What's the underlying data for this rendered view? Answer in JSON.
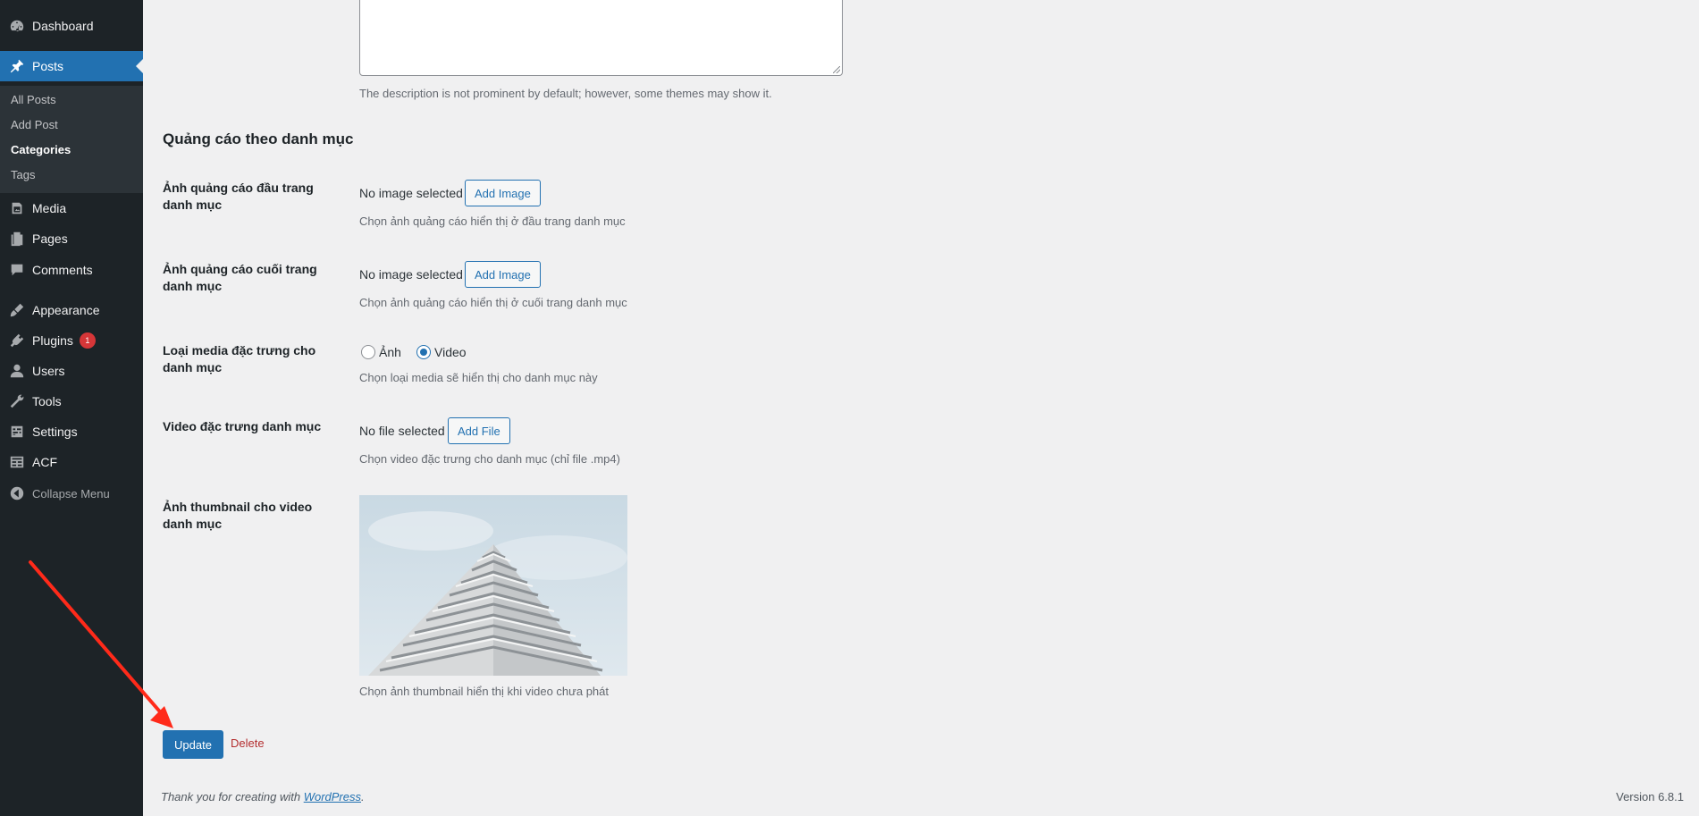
{
  "sidebar": {
    "items": [
      {
        "label": "Dashboard",
        "icon": "dashboard-icon"
      },
      {
        "label": "Posts",
        "icon": "pin-icon"
      },
      {
        "label": "Media",
        "icon": "media-icon"
      },
      {
        "label": "Pages",
        "icon": "pages-icon"
      },
      {
        "label": "Comments",
        "icon": "comments-icon"
      },
      {
        "label": "Appearance",
        "icon": "appearance-icon"
      },
      {
        "label": "Plugins",
        "icon": "plugins-icon",
        "badge": "1"
      },
      {
        "label": "Users",
        "icon": "users-icon"
      },
      {
        "label": "Tools",
        "icon": "tools-icon"
      },
      {
        "label": "Settings",
        "icon": "settings-icon"
      },
      {
        "label": "ACF",
        "icon": "acf-icon"
      }
    ],
    "submenu": [
      "All Posts",
      "Add Post",
      "Categories",
      "Tags"
    ],
    "collapse_label": "Collapse Menu"
  },
  "form": {
    "description_help": "The description is not prominent by default; however, some themes may show it.",
    "section_title": "Quảng cáo theo danh mục",
    "top_ad": {
      "label": "Ảnh quảng cáo đầu trang danh mục",
      "status": "No image selected",
      "button": "Add Image",
      "help": "Chọn ảnh quảng cáo hiển thị ở đầu trang danh mục"
    },
    "bottom_ad": {
      "label": "Ảnh quảng cáo cuối trang danh mục",
      "status": "No image selected",
      "button": "Add Image",
      "help": "Chọn ảnh quảng cáo hiển thị ở cuối trang danh mục"
    },
    "media_type": {
      "label": "Loại media đặc trưng cho danh mục",
      "option_image": "Ảnh",
      "option_video": "Video",
      "selected": "Video",
      "help": "Chọn loại media sẽ hiển thị cho danh mục này"
    },
    "video": {
      "label": "Video đặc trưng danh mục",
      "status": "No file selected",
      "button": "Add File",
      "help": "Chọn video đặc trưng cho danh mục (chỉ file .mp4)"
    },
    "thumbnail": {
      "label": "Ảnh thumbnail cho video danh mục",
      "help": "Chọn ảnh thumbnail hiển thị khi video chưa phát"
    },
    "update_label": "Update",
    "delete_label": "Delete"
  },
  "footer": {
    "thanks_prefix": "Thank you for creating with ",
    "wordpress_link": "WordPress",
    "thanks_suffix": ".",
    "version": "Version 6.8.1"
  },
  "colors": {
    "sidebar_bg": "#1d2327",
    "accent": "#2271b1",
    "annotation_arrow": "#ff2a1a"
  }
}
